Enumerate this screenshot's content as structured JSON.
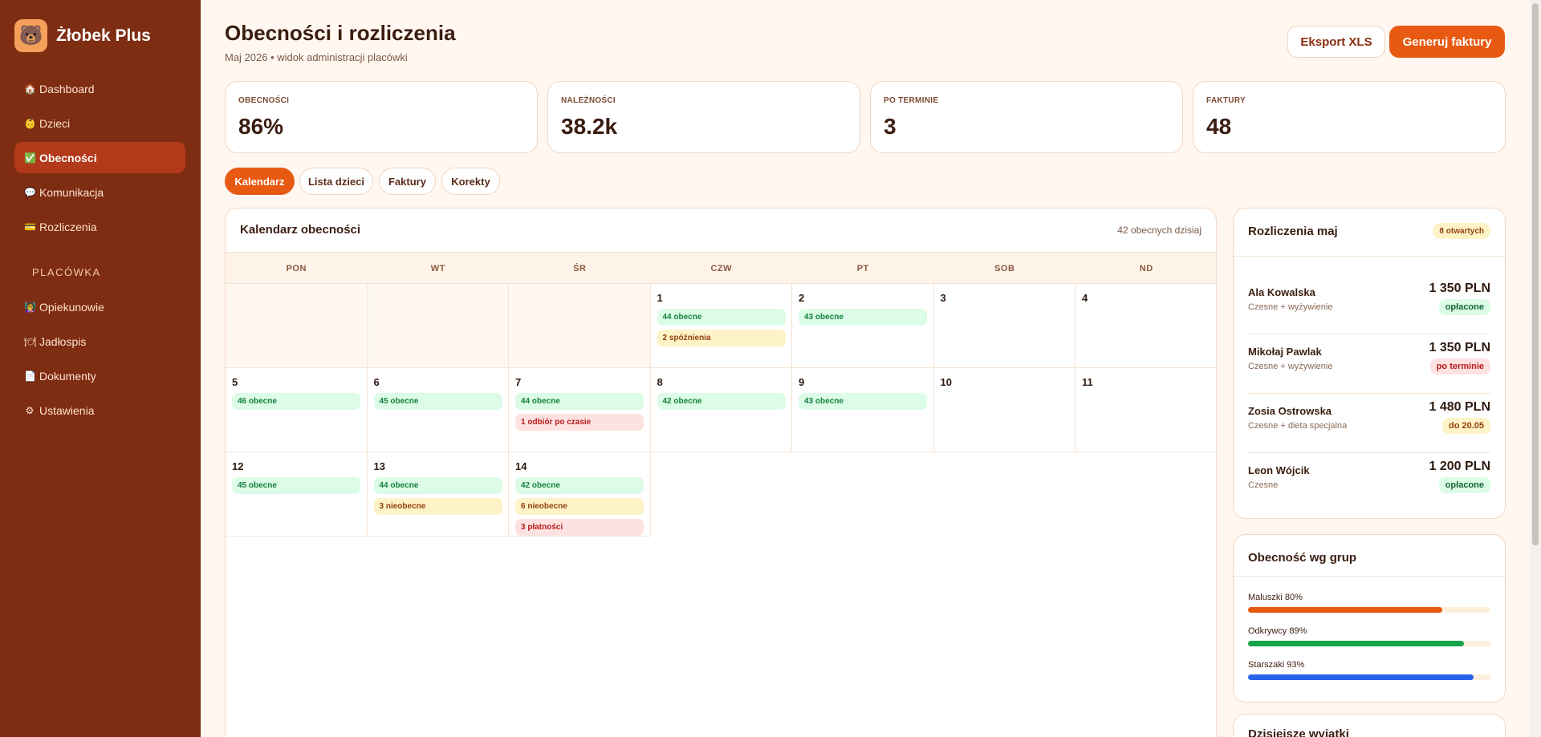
{
  "brand": {
    "logo_glyph": "🐻",
    "name": "Żłobek Plus"
  },
  "nav": {
    "items": [
      {
        "icon": "🏠",
        "icon_name": "home-icon",
        "label": "Dashboard",
        "active": false
      },
      {
        "icon": "👶",
        "icon_name": "baby-icon",
        "label": "Dzieci",
        "active": false
      },
      {
        "icon": "✅",
        "icon_name": "check-icon",
        "label": "Obecności",
        "active": true
      },
      {
        "icon": "💬",
        "icon_name": "chat-icon",
        "label": "Komunikacja",
        "active": false
      },
      {
        "icon": "💳",
        "icon_name": "card-icon",
        "label": "Rozliczenia",
        "active": false
      }
    ],
    "section_label": "PLACÓWKA",
    "section_items": [
      {
        "icon": "👩‍🏫",
        "icon_name": "teacher-icon",
        "label": "Opiekunowie"
      },
      {
        "icon": "🍽",
        "icon_name": "meal-icon",
        "label": "Jadłospis"
      },
      {
        "icon": "📄",
        "icon_name": "document-icon",
        "label": "Dokumenty"
      },
      {
        "icon": "⚙",
        "icon_name": "gear-icon",
        "label": "Ustawienia"
      }
    ]
  },
  "header": {
    "title": "Obecności i rozliczenia",
    "subtitle": "Maj 2026 • widok administracji placówki",
    "export_label": "Eksport XLS",
    "generate_label": "Generuj faktury"
  },
  "stats": [
    {
      "label": "OBECNOŚCI",
      "value": "86%"
    },
    {
      "label": "NALEŻNOŚCI",
      "value": "38.2k"
    },
    {
      "label": "PO TERMINIE",
      "value": "3"
    },
    {
      "label": "FAKTURY",
      "value": "48"
    }
  ],
  "tabs": [
    {
      "label": "Kalendarz",
      "active": true
    },
    {
      "label": "Lista dzieci",
      "active": false
    },
    {
      "label": "Faktury",
      "active": false
    },
    {
      "label": "Korekty",
      "active": false
    }
  ],
  "calendar": {
    "title": "Kalendarz obecności",
    "meta": "42 obecnych dzisiaj",
    "weekdays": [
      "PON",
      "WT",
      "ŚR",
      "CZW",
      "PT",
      "SOB",
      "ND"
    ],
    "weeks": [
      [
        {
          "day": "",
          "events": []
        },
        {
          "day": "",
          "events": []
        },
        {
          "day": "",
          "events": []
        },
        {
          "day": "1",
          "events": [
            {
              "text": "44 obecne",
              "kind": "green"
            },
            {
              "text": "2 spóźnienia",
              "kind": "yellow"
            }
          ]
        },
        {
          "day": "2",
          "events": [
            {
              "text": "43 obecne",
              "kind": "green"
            }
          ]
        },
        {
          "day": "3",
          "events": []
        },
        {
          "day": "4",
          "events": []
        }
      ],
      [
        {
          "day": "5",
          "events": [
            {
              "text": "46 obecne",
              "kind": "green"
            }
          ]
        },
        {
          "day": "6",
          "events": [
            {
              "text": "45 obecne",
              "kind": "green"
            }
          ]
        },
        {
          "day": "7",
          "events": [
            {
              "text": "44 obecne",
              "kind": "green"
            },
            {
              "text": "1 odbiór po czasie",
              "kind": "red"
            }
          ]
        },
        {
          "day": "8",
          "events": [
            {
              "text": "42 obecne",
              "kind": "green"
            }
          ]
        },
        {
          "day": "9",
          "events": [
            {
              "text": "43 obecne",
              "kind": "green"
            }
          ]
        },
        {
          "day": "10",
          "events": []
        },
        {
          "day": "11",
          "events": []
        }
      ],
      [
        {
          "day": "12",
          "events": [
            {
              "text": "45 obecne",
              "kind": "green"
            }
          ]
        },
        {
          "day": "13",
          "events": [
            {
              "text": "44 obecne",
              "kind": "green"
            },
            {
              "text": "3 nieobecne",
              "kind": "yellow"
            }
          ]
        },
        {
          "day": "14",
          "events": [
            {
              "text": "42 obecne",
              "kind": "green"
            },
            {
              "text": "6 nieobecne",
              "kind": "yellow"
            },
            {
              "text": "3 płatności",
              "kind": "red"
            }
          ]
        }
      ]
    ]
  },
  "billing": {
    "title": "Rozliczenia maj",
    "badge": "8 otwartych",
    "rows": [
      {
        "name": "Ala Kowalska",
        "desc": "Czesne + wyżywienie",
        "amount": "1 350 PLN",
        "status": "opłacone",
        "kind": "green"
      },
      {
        "name": "Mikołaj Pawlak",
        "desc": "Czesne + wyżywienie",
        "amount": "1 350 PLN",
        "status": "po terminie",
        "kind": "red"
      },
      {
        "name": "Zosia Ostrowska",
        "desc": "Czesne + dieta specjalna",
        "amount": "1 480 PLN",
        "status": "do 20.05",
        "kind": "yellow"
      },
      {
        "name": "Leon Wójcik",
        "desc": "Czesne",
        "amount": "1 200 PLN",
        "status": "opłacone",
        "kind": "green"
      }
    ]
  },
  "groups": {
    "title": "Obecność wg grup",
    "items": [
      {
        "label": "Maluszki 80%",
        "percent": 80,
        "color": "#e85a12"
      },
      {
        "label": "Odkrywcy 89%",
        "percent": 89,
        "color": "#16a34a"
      },
      {
        "label": "Starszaki 93%",
        "percent": 93,
        "color": "#2563eb"
      }
    ]
  },
  "exceptions": {
    "title": "Dzisiejsze wyjątki"
  },
  "colors": {
    "sidebar": "#7e2c12",
    "accent": "#e85a12",
    "background": "#fff7f0"
  }
}
